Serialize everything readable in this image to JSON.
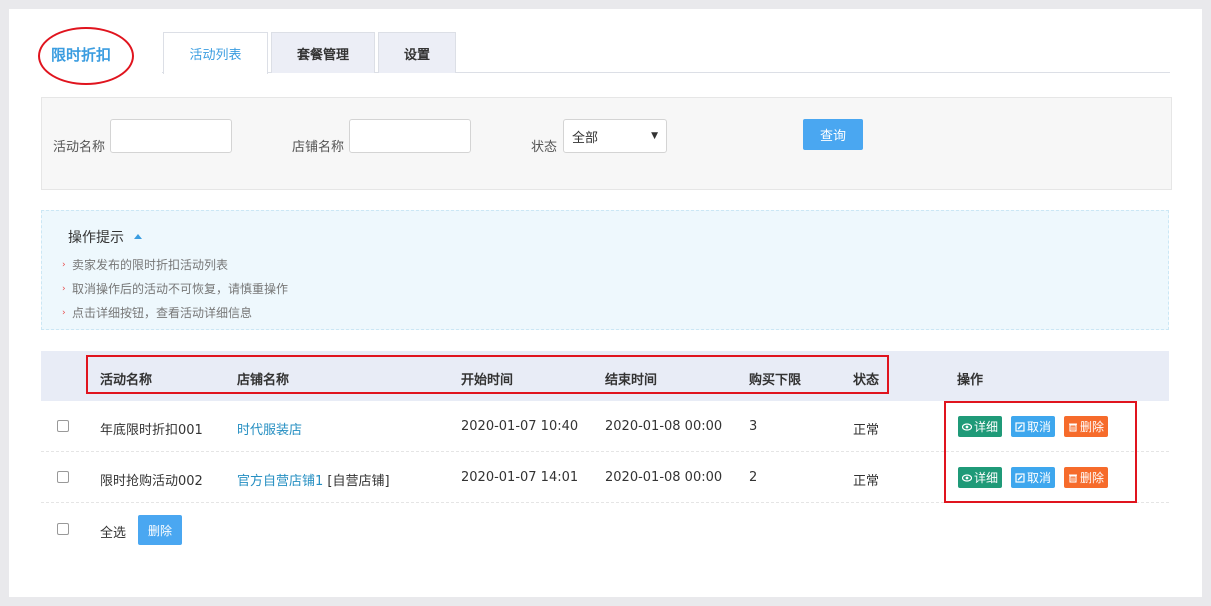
{
  "header": {
    "title": "限时折扣",
    "tabs": [
      {
        "label": "活动列表",
        "active": true
      },
      {
        "label": "套餐管理",
        "active": false
      },
      {
        "label": "设置",
        "active": false
      }
    ]
  },
  "search": {
    "activity_name_label": "活动名称",
    "activity_name_value": "",
    "store_name_label": "店铺名称",
    "store_name_value": "",
    "status_label": "状态",
    "status_selected": "全部",
    "query_button": "查询"
  },
  "tips": {
    "title": "操作提示",
    "items": [
      "卖家发布的限时折扣活动列表",
      "取消操作后的活动不可恢复，请慎重操作",
      "点击详细按钮，查看活动详细信息"
    ]
  },
  "table": {
    "columns": [
      "活动名称",
      "店铺名称",
      "开始时间",
      "结束时间",
      "购买下限",
      "状态",
      "操作"
    ],
    "rows": [
      {
        "name": "年底限时折扣001",
        "store": "时代服装店",
        "store_tag": "",
        "start": "2020-01-07 10:40",
        "end": "2020-01-08 00:00",
        "min_buy": "3",
        "status": "正常"
      },
      {
        "name": "限时抢购活动002",
        "store": "官方自营店铺1",
        "store_tag": "[自营店铺]",
        "start": "2020-01-07 14:01",
        "end": "2020-01-08 00:00",
        "min_buy": "2",
        "status": "正常"
      }
    ],
    "actions": {
      "detail": "详细",
      "cancel": "取消",
      "delete": "删除"
    }
  },
  "footer": {
    "select_all": "全选",
    "delete_button": "删除"
  },
  "colors": {
    "accent": "#3b9de0",
    "detail": "#1f9a78",
    "cancel": "#3ea7ee",
    "delete": "#f66b2b",
    "highlight": "#e0141e"
  },
  "icons": {
    "detail": "eye-icon",
    "cancel": "edit-icon",
    "delete": "trash-icon",
    "select": "caret-down-icon",
    "tips": "caret-up-icon"
  }
}
